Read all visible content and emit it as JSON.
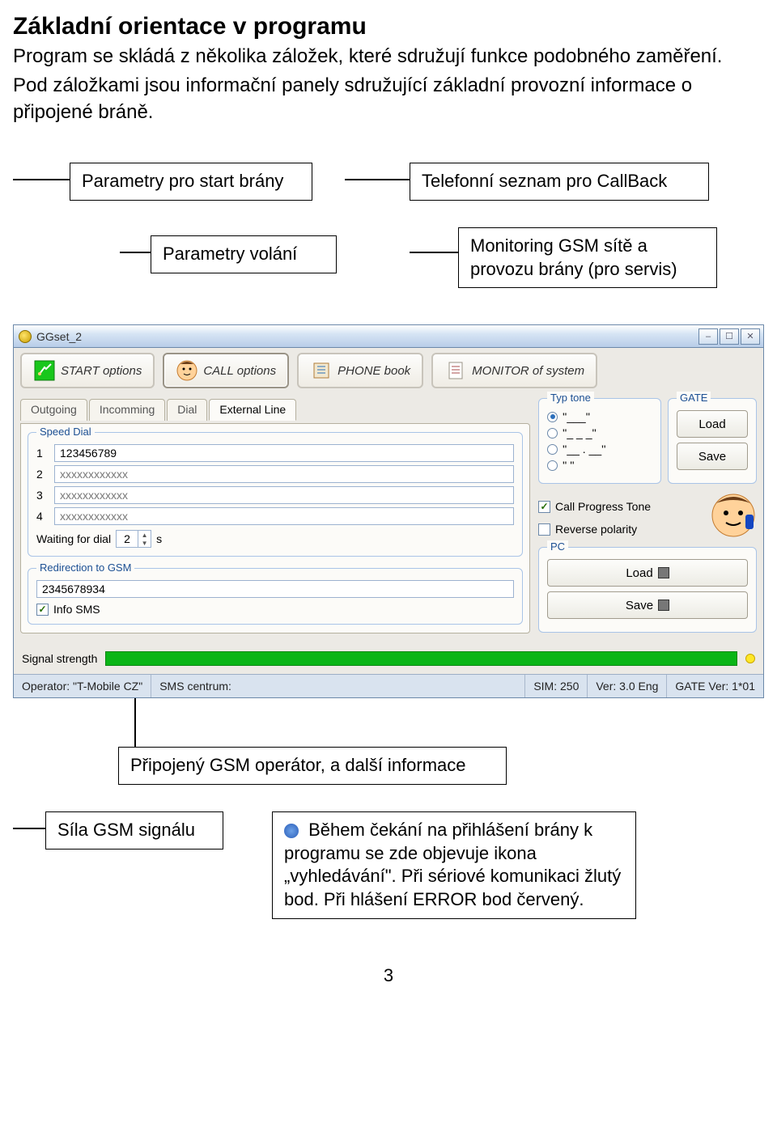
{
  "doc": {
    "heading": "Základní orientace v programu",
    "para1": "Program se skládá z několika záložek, které sdružují funkce podobného zaměření.",
    "para2": "Pod záložkami jsou informační panely sdružující základní provozní informace o připojené bráně.",
    "callout_params_start": "Parametry pro start brány",
    "callout_params_call": "Parametry volání",
    "callout_phonebook": "Telefonní seznam pro CallBack",
    "callout_monitoring": "Monitoring GSM sítě a provozu brány (pro servis)",
    "callout_operator": "Připojený GSM operátor, a další informace",
    "callout_signal": "Síla GSM signálu",
    "callout_waiting": "Během čekání na přihlášení brány k programu se zde objevuje ikona „vyhledávání\". Při sériové komunikaci žlutý bod. Při hlášení ERROR bod  červený.",
    "page_number": "3"
  },
  "window": {
    "title": "GGset_2",
    "toolbar": {
      "start": "START options",
      "call": "CALL options",
      "phonebook": "PHONE book",
      "monitor": "MONITOR of system"
    },
    "subtabs": [
      "Outgoing",
      "Incomming",
      "Dial",
      "External Line"
    ],
    "speed_dial": {
      "legend": "Speed Dial",
      "items": [
        {
          "idx": "1",
          "value": "123456789"
        },
        {
          "idx": "2",
          "value": "xxxxxxxxxxxx"
        },
        {
          "idx": "3",
          "value": "xxxxxxxxxxxx"
        },
        {
          "idx": "4",
          "value": "xxxxxxxxxxxx"
        }
      ],
      "waiting_label": "Waiting for dial",
      "waiting_value": "2",
      "waiting_unit": "s"
    },
    "redirection": {
      "legend": "Redirection to GSM",
      "number": "2345678934",
      "info_sms_label": "Info SMS",
      "info_sms_checked": true
    },
    "typ_tone": {
      "legend": "Typ tone",
      "options": [
        {
          "label": "''___''",
          "selected": true
        },
        {
          "label": "''_ _ _''",
          "selected": false
        },
        {
          "label": "''__ .  __''",
          "selected": false
        },
        {
          "label": "''       ''",
          "selected": false
        }
      ]
    },
    "gate": {
      "legend": "GATE",
      "load": "Load",
      "save": "Save"
    },
    "call_progress_label": "Call Progress Tone",
    "call_progress_checked": true,
    "reverse_polarity_label": "Reverse polarity",
    "reverse_polarity_checked": false,
    "pc": {
      "legend": "PC",
      "load": "Load",
      "save": "Save"
    },
    "signal_label": "Signal strength",
    "status": {
      "operator_label": "Operator:",
      "operator_value": "\"T-Mobile CZ\"",
      "sms_centrum": "SMS centrum:",
      "sim": "SIM: 250",
      "ver": "Ver: 3.0 Eng",
      "gate_ver": "GATE Ver: 1*01"
    }
  }
}
